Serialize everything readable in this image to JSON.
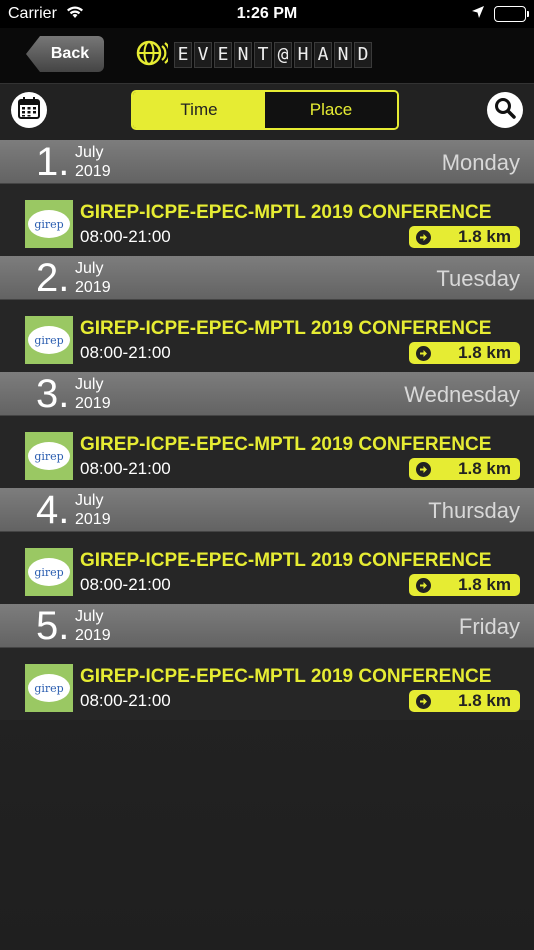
{
  "status_bar": {
    "carrier": "Carrier",
    "time": "1:26 PM"
  },
  "nav": {
    "back_label": "Back",
    "logo_text": "EVENT@HAND"
  },
  "toolbar": {
    "segments": [
      {
        "label": "Time",
        "selected": true
      },
      {
        "label": "Place",
        "selected": false
      }
    ]
  },
  "days": [
    {
      "day": "1.",
      "month": "July",
      "year": "2019",
      "weekday": "Monday",
      "event": {
        "title": "GIREP-ICPE-EPEC-MPTL 2019 CONFERENCE",
        "time": "08:00-21:00",
        "distance": "1.8 km",
        "thumb_text": "girep"
      }
    },
    {
      "day": "2.",
      "month": "July",
      "year": "2019",
      "weekday": "Tuesday",
      "event": {
        "title": "GIREP-ICPE-EPEC-MPTL 2019 CONFERENCE",
        "time": "08:00-21:00",
        "distance": "1.8 km",
        "thumb_text": "girep"
      }
    },
    {
      "day": "3.",
      "month": "July",
      "year": "2019",
      "weekday": "Wednesday",
      "event": {
        "title": "GIREP-ICPE-EPEC-MPTL 2019 CONFERENCE",
        "time": "08:00-21:00",
        "distance": "1.8 km",
        "thumb_text": "girep"
      }
    },
    {
      "day": "4.",
      "month": "July",
      "year": "2019",
      "weekday": "Thursday",
      "event": {
        "title": "GIREP-ICPE-EPEC-MPTL 2019 CONFERENCE",
        "time": "08:00-21:00",
        "distance": "1.8 km",
        "thumb_text": "girep"
      }
    },
    {
      "day": "5.",
      "month": "July",
      "year": "2019",
      "weekday": "Friday",
      "event": {
        "title": "GIREP-ICPE-EPEC-MPTL 2019 CONFERENCE",
        "time": "08:00-21:00",
        "distance": "1.8 km",
        "thumb_text": "girep"
      }
    }
  ],
  "colors": {
    "accent": "#e6ec33",
    "header_gray": "#6e6e6e",
    "background": "#262626"
  },
  "icons": {
    "wifi": "wifi-icon",
    "location": "location-arrow-icon",
    "battery": "battery-icon",
    "logo": "globe-signal-icon",
    "calendar": "calendar-icon",
    "search": "search-icon",
    "distance_arrow": "arrow-right-circle-icon"
  }
}
